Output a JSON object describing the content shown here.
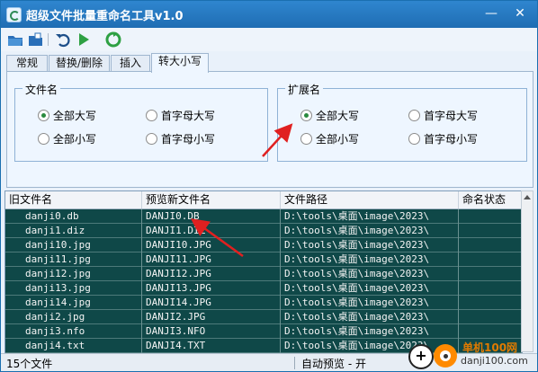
{
  "window": {
    "title": "超级文件批量重命名工具v1.0",
    "minimize": "—",
    "close": "✕"
  },
  "toolbar": {
    "buttons": [
      "open-folder-icon",
      "open-file-icon",
      "undo-icon",
      "run-icon",
      "recycle-icon"
    ]
  },
  "tabs": [
    {
      "label": "常规",
      "active": false
    },
    {
      "label": "替换/删除",
      "active": false
    },
    {
      "label": "插入",
      "active": false
    },
    {
      "label": "转大小写",
      "active": true
    }
  ],
  "panel": {
    "filename_group": {
      "label": "文件名",
      "options": [
        {
          "label": "全部大写",
          "selected": true
        },
        {
          "label": "首字母大写",
          "selected": false
        },
        {
          "label": "全部小写",
          "selected": false
        },
        {
          "label": "首字母小写",
          "selected": false
        }
      ]
    },
    "extension_group": {
      "label": "扩展名",
      "options": [
        {
          "label": "全部大写",
          "selected": true
        },
        {
          "label": "首字母大写",
          "selected": false
        },
        {
          "label": "全部小写",
          "selected": false
        },
        {
          "label": "首字母小写",
          "selected": false
        }
      ]
    }
  },
  "grid": {
    "columns": [
      "旧文件名",
      "预览新文件名",
      "文件路径",
      "命名状态"
    ],
    "rows": [
      [
        "danji0.db",
        "DANJI0.DB",
        "D:\\tools\\桌面\\image\\2023\\",
        ""
      ],
      [
        "danji1.diz",
        "DANJI1.DIZ",
        "D:\\tools\\桌面\\image\\2023\\",
        ""
      ],
      [
        "danji10.jpg",
        "DANJI10.JPG",
        "D:\\tools\\桌面\\image\\2023\\",
        ""
      ],
      [
        "danji11.jpg",
        "DANJI11.JPG",
        "D:\\tools\\桌面\\image\\2023\\",
        ""
      ],
      [
        "danji12.jpg",
        "DANJI12.JPG",
        "D:\\tools\\桌面\\image\\2023\\",
        ""
      ],
      [
        "danji13.jpg",
        "DANJI13.JPG",
        "D:\\tools\\桌面\\image\\2023\\",
        ""
      ],
      [
        "danji14.jpg",
        "DANJI14.JPG",
        "D:\\tools\\桌面\\image\\2023\\",
        ""
      ],
      [
        "danji2.jpg",
        "DANJI2.JPG",
        "D:\\tools\\桌面\\image\\2023\\",
        ""
      ],
      [
        "danji3.nfo",
        "DANJI3.NFO",
        "D:\\tools\\桌面\\image\\2023\\",
        ""
      ],
      [
        "danji4.txt",
        "DANJI4.TXT",
        "D:\\tools\\桌面\\image\\2023\\",
        ""
      ]
    ]
  },
  "statusbar": {
    "file_count": "15个文件",
    "auto_preview": "自动预览 - 开"
  },
  "watermark": {
    "site_name": "单机100网",
    "site_url": "danji100.com",
    "plus": "+"
  },
  "colors": {
    "titlebar": "#1f6db3",
    "grid_background": "#0f4848",
    "annotation_arrow": "#e02020"
  }
}
